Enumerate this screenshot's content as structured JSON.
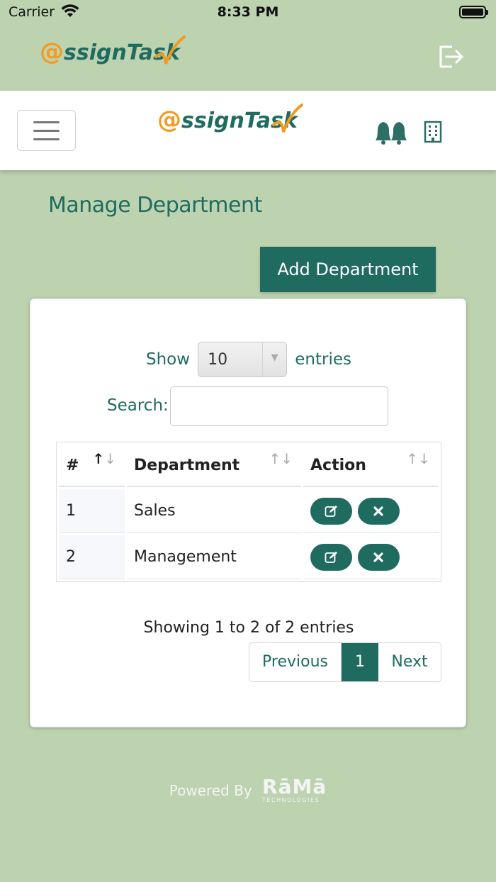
{
  "status_bar": {
    "carrier": "Carrier",
    "time": "8:33 PM"
  },
  "brand": {
    "at": "@",
    "name": "ssign",
    "task": "Task"
  },
  "page": {
    "title": "Manage Department",
    "add_button": "Add Department"
  },
  "table_controls": {
    "show_label": "Show",
    "entries_value": "10",
    "entries_label": "entries",
    "search_label": "Search:",
    "search_value": ""
  },
  "table": {
    "headers": [
      "#",
      "Department",
      "Action"
    ],
    "rows": [
      {
        "num": "1",
        "department": "Sales"
      },
      {
        "num": "2",
        "department": "Management"
      }
    ]
  },
  "pagination": {
    "info": "Showing 1 to 2 of 2 entries",
    "previous": "Previous",
    "current": "1",
    "next": "Next"
  },
  "footer": {
    "powered_by": "Powered By",
    "company": "RāMā",
    "company_sub": "TECHNOLOGIES"
  },
  "icons": [
    "wifi-icon",
    "battery-icon",
    "logout-icon",
    "hamburger-icon",
    "bell-icon",
    "building-icon",
    "edit-icon",
    "delete-icon",
    "sort-icon"
  ],
  "colors": {
    "background": "#bdd3b0",
    "primary": "#1f6b60",
    "accent": "#f39a1f"
  }
}
